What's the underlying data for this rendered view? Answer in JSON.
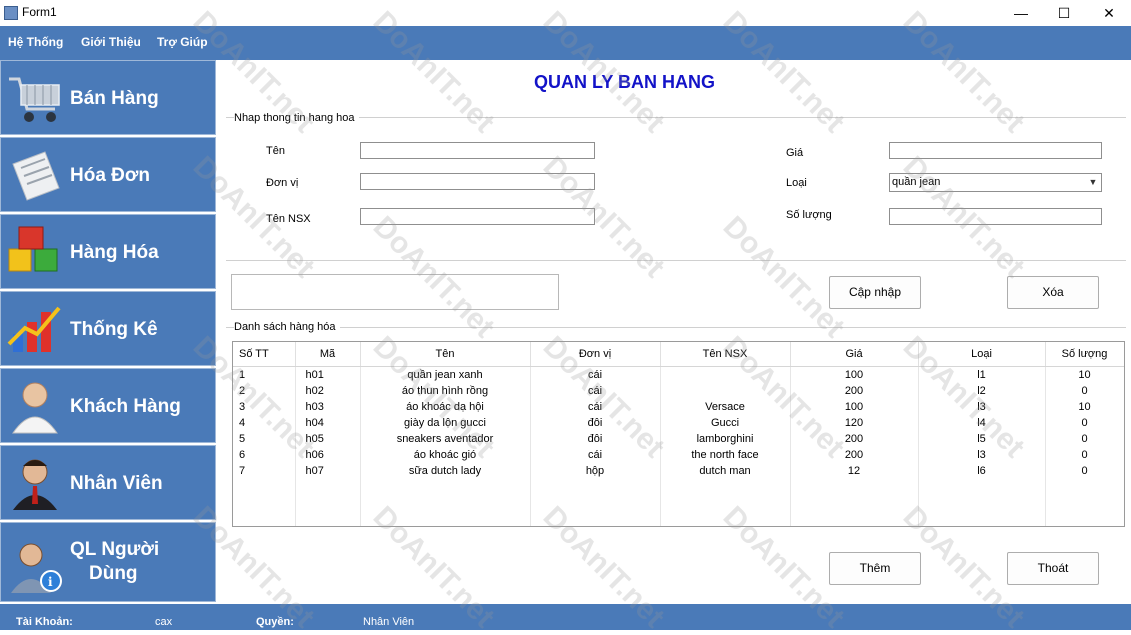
{
  "window": {
    "title": "Form1",
    "minimize_label": "—",
    "maximize_label": "☐",
    "close_label": "✕"
  },
  "menu": {
    "items": [
      "Hệ Thống",
      "Giới Thiệu",
      "Trợ Giúp"
    ]
  },
  "sidebar": {
    "items": [
      {
        "label": "Bán Hàng",
        "icon": "shopping-cart-icon"
      },
      {
        "label": "Hóa Đơn",
        "icon": "invoice-icon"
      },
      {
        "label": "Hàng Hóa",
        "icon": "boxes-icon"
      },
      {
        "label": "Thống Kê",
        "icon": "bar-chart-icon"
      },
      {
        "label": "Khách Hàng",
        "icon": "customer-icon"
      },
      {
        "label": "Nhân Viên",
        "icon": "employee-icon"
      },
      {
        "label": "QL Người Dùng",
        "label_line1": "QL Người",
        "label_line2": "Dùng",
        "icon": "user-admin-icon"
      }
    ]
  },
  "main": {
    "title": "QUAN LY BAN HANG",
    "input_group": {
      "label": "Nhap thong tin hang hoa",
      "fields": {
        "ten": {
          "label": "Tên",
          "value": ""
        },
        "don_vi": {
          "label": "Đơn vị",
          "value": ""
        },
        "ten_nsx": {
          "label": "Tên NSX",
          "value": ""
        },
        "gia": {
          "label": "Giá",
          "value": ""
        },
        "loai": {
          "label": "Loại",
          "value": "quần jean"
        },
        "so_luong": {
          "label": "Số lượng",
          "value": ""
        }
      }
    },
    "buttons": {
      "update": "Cập nhập",
      "delete": "Xóa",
      "add": "Thêm",
      "exit": "Thoát"
    },
    "list_group": {
      "label": "Danh sách hàng hóa",
      "columns": [
        "Số TT",
        "Mã",
        "Tên",
        "Đơn vị",
        "Tên NSX",
        "Giá",
        "Loại",
        "Số lượng"
      ],
      "rows": [
        [
          "1",
          "h01",
          "quần jean xanh",
          "cái",
          "",
          "100",
          "l1",
          "10"
        ],
        [
          "2",
          "h02",
          "áo thun hình rồng",
          "cái",
          "",
          "200",
          "l2",
          "0"
        ],
        [
          "3",
          "h03",
          "áo khoác dạ hội",
          "cái",
          "Versace",
          "100",
          "l3",
          "10"
        ],
        [
          "4",
          "h04",
          "giày da lộn gucci",
          "đôi",
          "Gucci",
          "120",
          "l4",
          "0"
        ],
        [
          "5",
          "h05",
          "sneakers aventador",
          "đôi",
          "lamborghini",
          "200",
          "l5",
          "0"
        ],
        [
          "6",
          "h06",
          "áo khoác gió",
          "cái",
          "the north face",
          "200",
          "l3",
          "0"
        ],
        [
          "7",
          "h07",
          "sữa dutch lady",
          "hộp",
          "dutch man",
          "12",
          "l6",
          "0"
        ]
      ]
    }
  },
  "statusbar": {
    "account_label": "Tài Khoản:",
    "account_value": "cax",
    "role_label": "Quyền:",
    "role_value": "Nhân Viên"
  },
  "colors": {
    "menu_bg": "#4a7ab8",
    "title_color": "#1313c8"
  },
  "watermark_text": "DoAnIT.net"
}
